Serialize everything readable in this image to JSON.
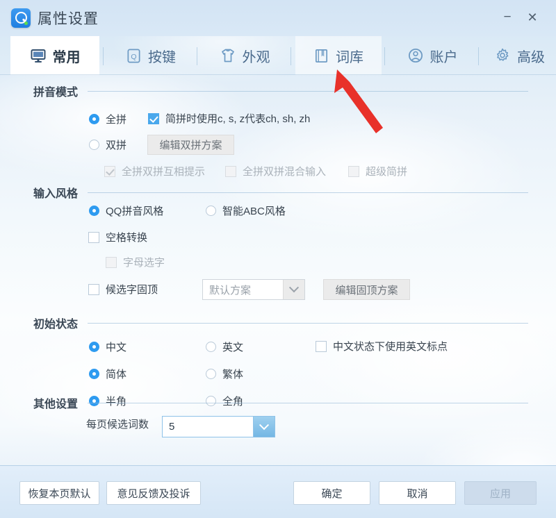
{
  "window": {
    "title": "属性设置",
    "logo_icon": "qq-pinyin-logo-icon",
    "minimize_label": "−",
    "close_label": "✕"
  },
  "tabs": [
    {
      "label": "常用",
      "icon": "monitor-icon",
      "active": true,
      "hovered": false
    },
    {
      "label": "按键",
      "icon": "key-q-icon",
      "active": false,
      "hovered": false
    },
    {
      "label": "外观",
      "icon": "tshirt-icon",
      "active": false,
      "hovered": false
    },
    {
      "label": "词库",
      "icon": "book-icon",
      "active": false,
      "hovered": true
    },
    {
      "label": "账户",
      "icon": "user-circle-icon",
      "active": false,
      "hovered": false
    },
    {
      "label": "高级",
      "icon": "gear-icon",
      "active": false,
      "hovered": false
    }
  ],
  "sections": {
    "pinyin_mode": {
      "title": "拼音模式",
      "radio_quanpin": {
        "label": "全拼",
        "checked": true
      },
      "radio_shuangpin": {
        "label": "双拼",
        "checked": false
      },
      "check_jianpin": {
        "label": "简拼时使用c, s, z代表ch, sh, zh",
        "checked": true,
        "disabled": false
      },
      "button_edit_shuangpin": "编辑双拼方案",
      "check_mutual_hint": {
        "label": "全拼双拼互相提示",
        "checked": true,
        "disabled": true
      },
      "check_mixed_input": {
        "label": "全拼双拼混合输入",
        "checked": false,
        "disabled": true
      },
      "check_super_jianpin": {
        "label": "超级简拼",
        "checked": false,
        "disabled": true
      }
    },
    "input_style": {
      "title": "输入风格",
      "radio_qq_style": {
        "label": "QQ拼音风格",
        "checked": true
      },
      "radio_abc_style": {
        "label": "智能ABC风格",
        "checked": false
      },
      "check_space_convert": {
        "label": "空格转换",
        "checked": false,
        "disabled": false
      },
      "check_letter_select": {
        "label": "字母选字",
        "checked": false,
        "disabled": true
      },
      "check_pin_top": {
        "label": "候选字固顶",
        "checked": false,
        "disabled": false
      },
      "select_scheme": {
        "value": "默认方案",
        "icon": "chevron-down-icon"
      },
      "button_edit_pin_top": "编辑固顶方案"
    },
    "initial_state": {
      "title": "初始状态",
      "radio_chinese": {
        "label": "中文",
        "checked": true
      },
      "radio_english": {
        "label": "英文",
        "checked": false
      },
      "check_en_punct": {
        "label": "中文状态下使用英文标点",
        "checked": false
      },
      "radio_simplified": {
        "label": "简体",
        "checked": true
      },
      "radio_traditional": {
        "label": "繁体",
        "checked": false
      },
      "radio_halfwidth": {
        "label": "半角",
        "checked": true
      },
      "radio_fullwidth": {
        "label": "全角",
        "checked": false
      }
    },
    "other_settings": {
      "title": "其他设置",
      "candidates_label": "每页候选词数",
      "candidates_value": "5",
      "candidates_icon": "chevron-down-icon"
    }
  },
  "footer": {
    "restore_defaults": "恢复本页默认",
    "feedback": "意见反馈及投诉",
    "ok": "确定",
    "cancel": "取消",
    "apply": "应用"
  },
  "annotation": {
    "arrow_icon": "red-arrow-annotation-icon",
    "color": "#e8312a"
  },
  "colors": {
    "accent": "#2e9bf0",
    "title_text": "#3b4856",
    "tab_text": "#4a6a8c",
    "body_text": "#39444f",
    "disabled_text": "#aab2ba"
  }
}
